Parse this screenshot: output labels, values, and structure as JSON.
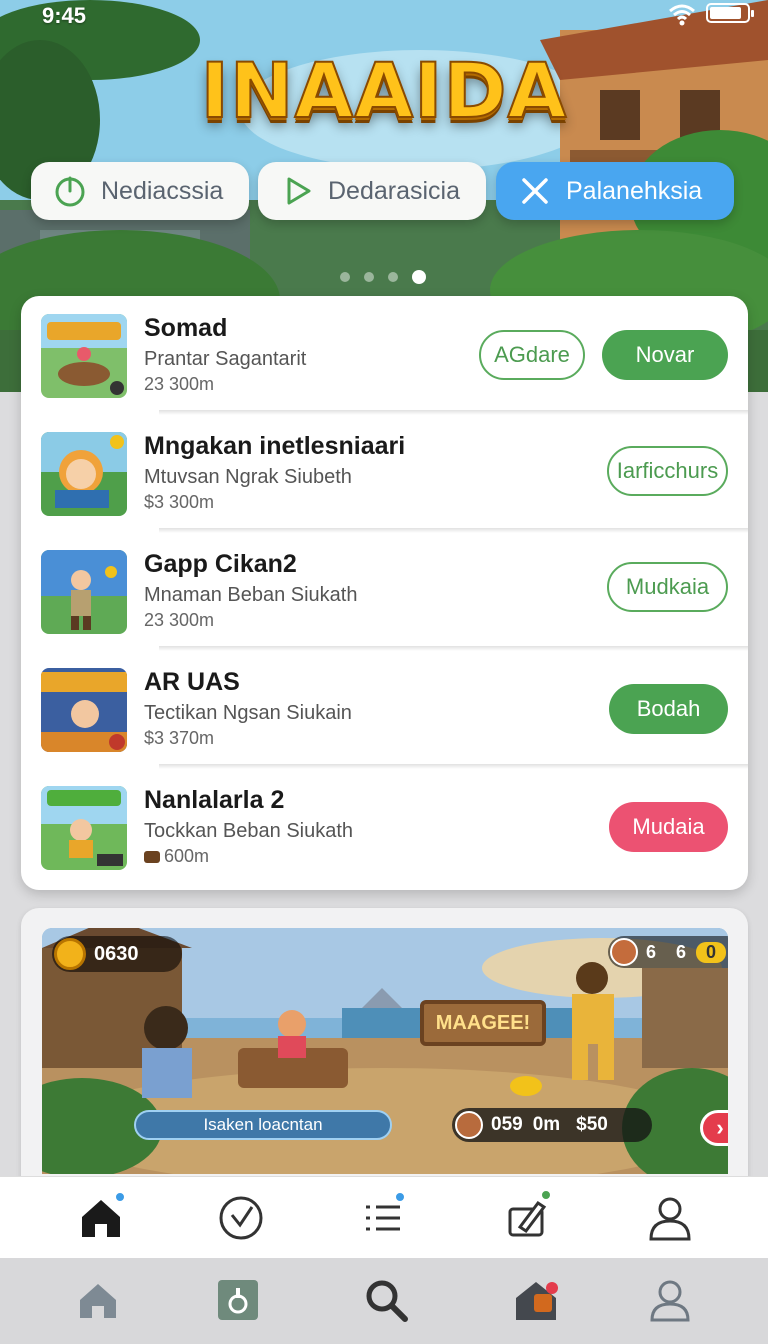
{
  "status": {
    "time": "9:45",
    "battery_level": 0.85
  },
  "hero": {
    "title": "INAAIDA",
    "pills": [
      {
        "label": "Nediacssia",
        "icon": "power-icon"
      },
      {
        "label": "Dedarasicia",
        "icon": "play-icon"
      },
      {
        "label": "Palanehksia",
        "icon": "close-icon"
      }
    ],
    "carousel": {
      "pages": 4,
      "active": 3
    }
  },
  "list": [
    {
      "title": "Somad",
      "subtitle": "Prantar Sagantarit",
      "meta": "23 300m",
      "buttons": [
        {
          "label": "AGdare",
          "style": "outline"
        },
        {
          "label": "Novar",
          "style": "green"
        }
      ]
    },
    {
      "title": "Mngakan inetlesniaari",
      "subtitle": "Mtuvsan Ngrak Siubeth",
      "meta": "$3 300m",
      "buttons": [
        {
          "label": "Iarficchurs",
          "style": "outline"
        }
      ]
    },
    {
      "title": "Gapp Cikan2",
      "subtitle": "Mnaman Beban Siukath",
      "meta": "23 300m",
      "buttons": [
        {
          "label": "Mudkaia",
          "style": "outline"
        }
      ]
    },
    {
      "title": "AR UAS",
      "subtitle": "Tectikan Ngsan Siukain",
      "meta": "$3 370m",
      "buttons": [
        {
          "label": "Bodah",
          "style": "green"
        }
      ]
    },
    {
      "title": "Nanlalarla 2",
      "subtitle": "Tockkan Beban Siukath",
      "meta": "600m",
      "buttons": [
        {
          "label": "Mudaia",
          "style": "red"
        }
      ]
    }
  ],
  "game": {
    "coins": "0630",
    "stat_a": "6",
    "stat_b": "6",
    "stat_c": "0",
    "sign": "MAAGEE!",
    "input_text": "Isaken loacntan",
    "score": "059",
    "score_unit": "0m",
    "price": "$50"
  },
  "tabbar": {
    "tabs": [
      {
        "name": "home",
        "icon": "home-icon",
        "badge": "#3b9be6"
      },
      {
        "name": "check",
        "icon": "check-circle-icon",
        "badge": ""
      },
      {
        "name": "list",
        "icon": "list-icon",
        "badge": "#3b9be6"
      },
      {
        "name": "edit",
        "icon": "edit-icon",
        "badge": "#4ba352"
      },
      {
        "name": "profile",
        "icon": "profile-icon",
        "badge": ""
      }
    ]
  },
  "colors": {
    "accent_green": "#4ba352",
    "accent_blue": "#49a6f0",
    "accent_red": "#ec5272"
  }
}
